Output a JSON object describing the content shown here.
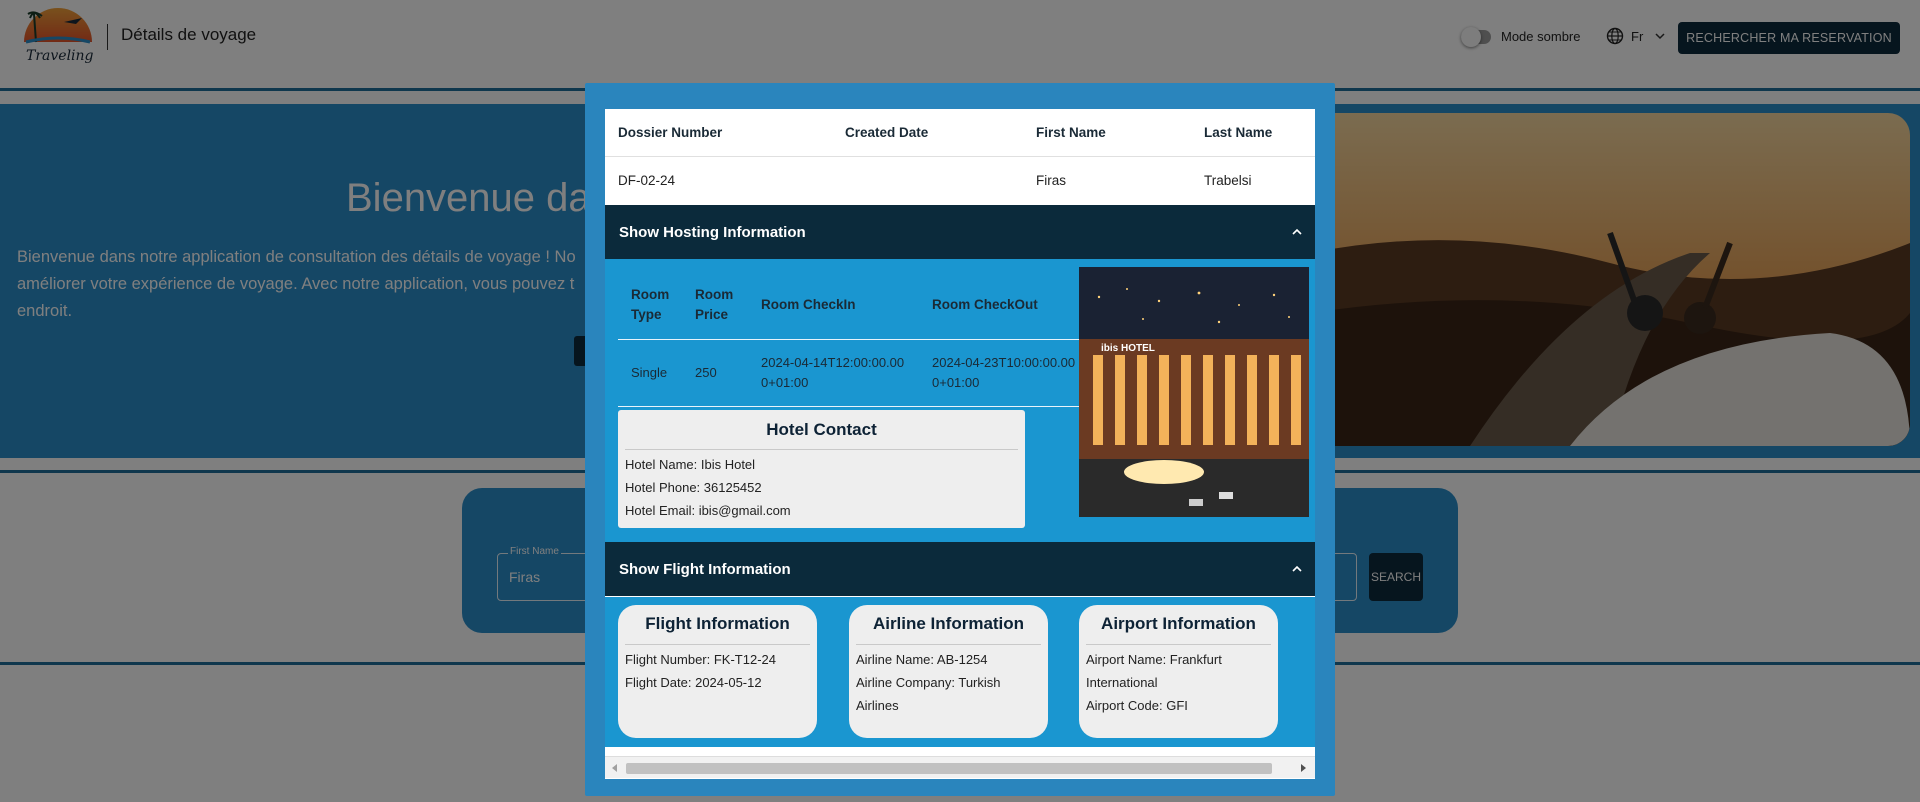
{
  "header": {
    "title": "Détails de voyage",
    "logo_text": "Traveling",
    "dark_mode_label": "Mode sombre",
    "language": "Fr",
    "reservation_button": "RECHERCHER MA RESERVATION"
  },
  "hero": {
    "title": "Bienvenue da",
    "text": "Bienvenue dans notre application de consultation des détails de voyage ! No améliorer votre expérience de voyage. Avec notre application, vous pouvez t endroit."
  },
  "search": {
    "first_name_label": "First Name",
    "first_name_value": "Firas",
    "button": "SEARCH"
  },
  "modal": {
    "dossier_table": {
      "headers": [
        "Dossier Number",
        "Created Date",
        "First Name",
        "Last Name"
      ],
      "row": [
        "DF-02-24",
        "",
        "Firas",
        "Trabelsi"
      ]
    },
    "hosting": {
      "toggle_label": "Show Hosting Information",
      "room_headers": [
        "Room Type",
        "Room Price",
        "Room CheckIn",
        "Room CheckOut"
      ],
      "room_row": [
        "Single",
        "250",
        "2024-04-14T12:00:00.000+01:00",
        "2024-04-23T10:00:00.000+01:00"
      ],
      "hotel_sign": "ibis HOTEL",
      "contact": {
        "title": "Hotel Contact",
        "name": "Hotel Name: Ibis Hotel",
        "phone": "Hotel Phone: 36125452",
        "email": "Hotel Email: ibis@gmail.com"
      }
    },
    "flight": {
      "toggle_label": "Show Flight Information",
      "flight_info": {
        "title": "Flight Information",
        "lines": [
          "Flight Number: FK-T12-24",
          "Flight Date: 2024-05-12"
        ]
      },
      "airline_info": {
        "title": "Airline Information",
        "lines": [
          "Airline Name: AB-1254",
          "Airline Company: Turkish",
          "Airlines"
        ]
      },
      "airport_info": {
        "title": "Airport Information",
        "lines": [
          "Airport Name: Frankfurt",
          "International",
          "Airport Code: GFI"
        ]
      }
    }
  },
  "colors": {
    "navy": "#0b2a3b",
    "accent_blue": "#2a8ecb",
    "panel_blue": "#1a96d0",
    "card_gray": "#eeeeee"
  }
}
